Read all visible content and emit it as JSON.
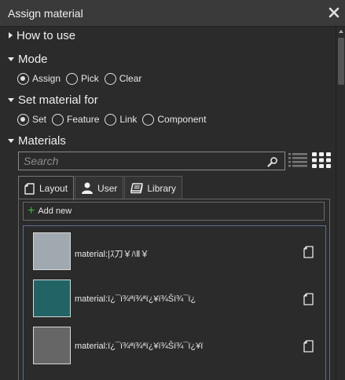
{
  "window": {
    "title": "Assign material"
  },
  "sections": {
    "how_to_use": "How to use",
    "mode": "Mode",
    "set_material_for": "Set material for",
    "materials": "Materials"
  },
  "mode": {
    "options": [
      "Assign",
      "Pick",
      "Clear"
    ],
    "selected": "Assign"
  },
  "set_material_for": {
    "options": [
      "Set",
      "Feature",
      "Link",
      "Component"
    ],
    "selected": "Set"
  },
  "search": {
    "placeholder": "Search"
  },
  "tabs": [
    {
      "label": "Layout",
      "icon": "document-icon",
      "active": true
    },
    {
      "label": "User",
      "icon": "user-icon",
      "active": false
    },
    {
      "label": "Library",
      "icon": "book-icon",
      "active": false
    }
  ],
  "add_new": {
    "label": "Add new"
  },
  "materials": [
    {
      "name": "material:|ｽ刀￥ﾊⅡ￥",
      "color": "#a0a8b0",
      "icon": "document-icon"
    },
    {
      "name": "material:ï¿¯ï¾ªï¾ªï¿¥ï¾Šï¾¯ï¿",
      "color": "#226466",
      "icon": "document-icon"
    },
    {
      "name": "material:ï¿¯ï¾ªï¾ªï¿¥ï¾Šï¾¯ï¿¥ï",
      "color": "#666666",
      "icon": "document-icon"
    }
  ],
  "icons": {
    "close": "close-icon",
    "search": "search-icon",
    "list_view": "list-view-icon",
    "grid_view": "grid-view-icon",
    "add": "plus-icon"
  }
}
